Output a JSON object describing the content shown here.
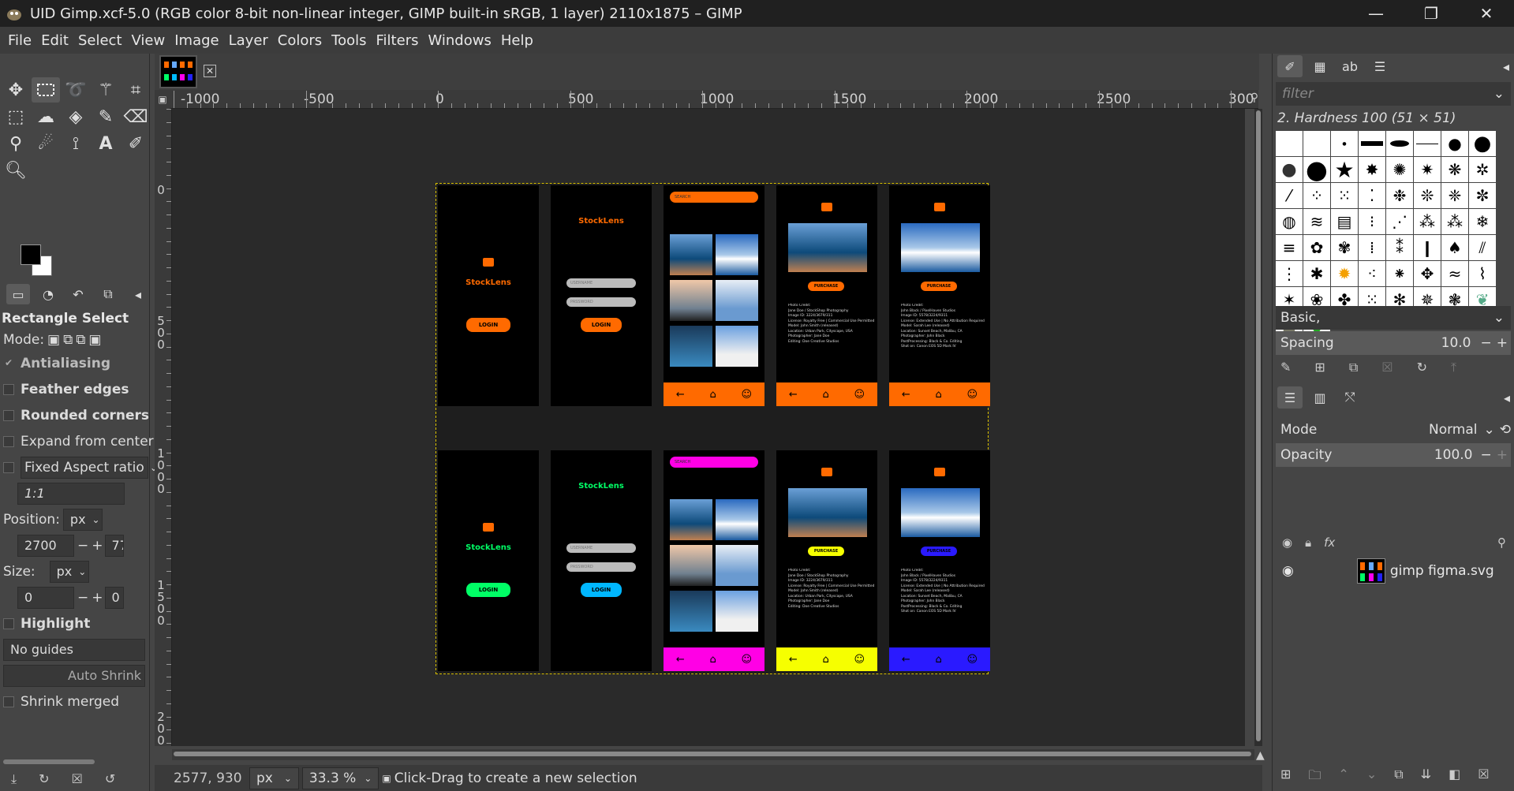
{
  "window": {
    "title": "UID Gimp.xcf-5.0 (RGB color 8-bit non-linear integer, GIMP built-in sRGB, 1 layer) 2110x1875 – GIMP",
    "minimize": "—",
    "maximize": "❐",
    "close": "✕"
  },
  "menu": [
    "File",
    "Edit",
    "Select",
    "View",
    "Image",
    "Layer",
    "Colors",
    "Tools",
    "Filters",
    "Windows",
    "Help"
  ],
  "ruler": {
    "h_labels": [
      "-1000",
      "-500",
      "0",
      "500",
      "1000",
      "1500",
      "2000",
      "2500",
      "300"
    ],
    "v_labels": [
      "0",
      "500",
      "1000",
      "1500",
      "2000"
    ]
  },
  "tool_options": {
    "title": "Rectangle Select",
    "mode_label": "Mode:",
    "antialiasing": "Antialiasing",
    "feather": "Feather edges",
    "rounded": "Rounded corners",
    "expand": "Expand from center",
    "fixed": "Fixed Aspect ratio",
    "ratio_value": "1:1",
    "position_label": "Position:",
    "position_unit": "px",
    "position_x": "2700",
    "position_y": "774",
    "size_label": "Size:",
    "size_unit": "px",
    "size_w": "0",
    "size_h": "0",
    "highlight": "Highlight",
    "guides": "No guides",
    "auto_shrink": "Auto Shrink",
    "shrink_merged": "Shrink merged"
  },
  "design": {
    "brand": "StockLens",
    "login": "LOGIN",
    "purchase": "PURCHASE",
    "search": "SEARCH",
    "username": "USERNAME",
    "password": "PASSWORD",
    "info_1": [
      "Photo Credit:",
      "Jane Doe / StockShop Photography",
      "Image ID: 3224/3679/311",
      "License: Royalty Free | Commercial Use Permitted",
      "Model: John Smith (released)",
      "Location: Urban Park, Cityscape, USA",
      "Photographer: Jane Doe",
      "Editing: Doe Creative Studios"
    ],
    "info_2": [
      "Photo Credit:",
      "John Black / PixelHaven Studios",
      "Image ID: 5578/3224/9311",
      "License: Extended Use | No Attribution Required",
      "Model: Sarah Lee (released)",
      "Location: Sunset Beach, Malibu, CA",
      "Photographer: John Black",
      "PostProcessing: Black & Co. Editing",
      "Shot on: Canon EOS 5D Mark IV"
    ],
    "colors": {
      "orange": "#ff6a00",
      "magenta": "#ff00e5",
      "yellow": "#f6ff00",
      "blue": "#2a1aff",
      "green": "#00ff66",
      "cyan": "#00b7ff"
    }
  },
  "statusbar": {
    "coords": "2577, 930",
    "unit": "px",
    "zoom": "33.3 %",
    "message": "Click-Drag to create a new selection"
  },
  "brushes": {
    "filter_placeholder": "filter",
    "selected": "2. Hardness 100 (51 × 51)",
    "preset": "Basic,",
    "spacing_label": "Spacing",
    "spacing_value": "10.0"
  },
  "layers": {
    "mode_label": "Mode",
    "mode_value": "Normal",
    "opacity_label": "Opacity",
    "opacity_value": "100.0",
    "layer_name": "gimp figma.svg"
  }
}
